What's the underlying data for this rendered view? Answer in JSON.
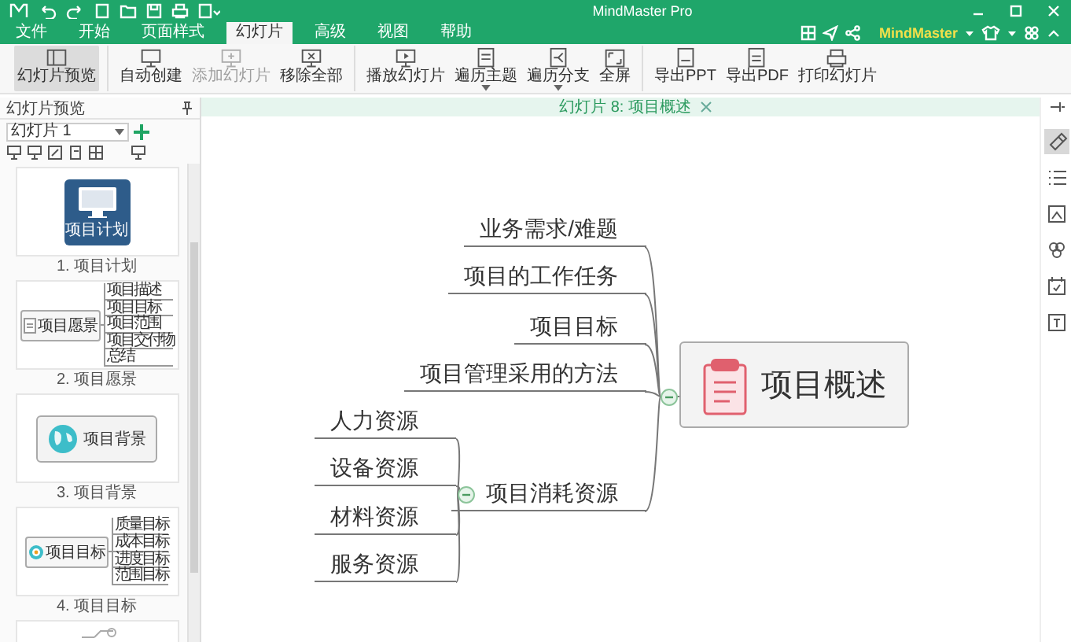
{
  "window": {
    "title": "MindMaster Pro",
    "account": "MindMaster"
  },
  "menu_tabs": [
    {
      "label": "文件",
      "selected": false
    },
    {
      "label": "开始",
      "selected": false
    },
    {
      "label": "页面样式",
      "selected": false
    },
    {
      "label": "幻灯片",
      "selected": true
    },
    {
      "label": "高级",
      "selected": false
    },
    {
      "label": "视图",
      "selected": false
    },
    {
      "label": "帮助",
      "selected": false
    }
  ],
  "ribbon_groups": [
    [
      {
        "label": "幻灯片预览",
        "selected": true,
        "disabled": false,
        "dropdown": false
      }
    ],
    [
      {
        "label": "自动创建",
        "selected": false,
        "disabled": false,
        "dropdown": false
      },
      {
        "label": "添加幻灯片",
        "selected": false,
        "disabled": true,
        "dropdown": false
      },
      {
        "label": "移除全部",
        "selected": false,
        "disabled": false,
        "dropdown": false
      }
    ],
    [
      {
        "label": "播放幻灯片",
        "selected": false,
        "disabled": false,
        "dropdown": false
      },
      {
        "label": "遍历主题",
        "selected": false,
        "disabled": false,
        "dropdown": true
      },
      {
        "label": "遍历分支",
        "selected": false,
        "disabled": false,
        "dropdown": true
      },
      {
        "label": "全屏",
        "selected": false,
        "disabled": false,
        "dropdown": false
      }
    ],
    [
      {
        "label": "导出PPT",
        "selected": false,
        "disabled": false,
        "dropdown": false
      },
      {
        "label": "导出PDF",
        "selected": false,
        "disabled": false,
        "dropdown": false
      },
      {
        "label": "打印幻灯片",
        "selected": false,
        "disabled": false,
        "dropdown": false
      }
    ]
  ],
  "sidebar": {
    "title": "幻灯片预览",
    "slide_select": "幻灯片 1",
    "slides": [
      {
        "kind": "title",
        "title": "项目计划",
        "caption": "1. 项目计划"
      },
      {
        "kind": "tree",
        "title": "项目愿景",
        "branches": [
          "项目描述",
          "项目目标",
          "项目范围",
          "项目交付物",
          "总结"
        ],
        "caption": "2. 项目愿景"
      },
      {
        "kind": "topic",
        "title": "项目背景",
        "caption": "3. 项目背景"
      },
      {
        "kind": "tree",
        "title": "项目目标",
        "branches": [
          "质量目标",
          "成本目标",
          "进度目标",
          "范围目标"
        ],
        "caption": "4. 项目目标"
      },
      {
        "kind": "partial"
      }
    ]
  },
  "document_tab": {
    "label": "幻灯片 8: 项目概述"
  },
  "right_tools": [
    {
      "selected": true
    },
    {
      "selected": false
    },
    {
      "selected": false
    },
    {
      "selected": false
    },
    {
      "selected": false
    },
    {
      "selected": false
    }
  ],
  "mind_map": {
    "central": "项目概述",
    "expanded": true,
    "branches": [
      {
        "label": "业务需求/难题"
      },
      {
        "label": "项目的工作任务"
      },
      {
        "label": "项目目标"
      },
      {
        "label": "项目管理采用的方法"
      },
      {
        "label": "项目消耗资源",
        "expanded": true,
        "children": [
          {
            "label": "人力资源"
          },
          {
            "label": "设备资源"
          },
          {
            "label": "材料资源"
          },
          {
            "label": "服务资源"
          }
        ]
      }
    ]
  }
}
